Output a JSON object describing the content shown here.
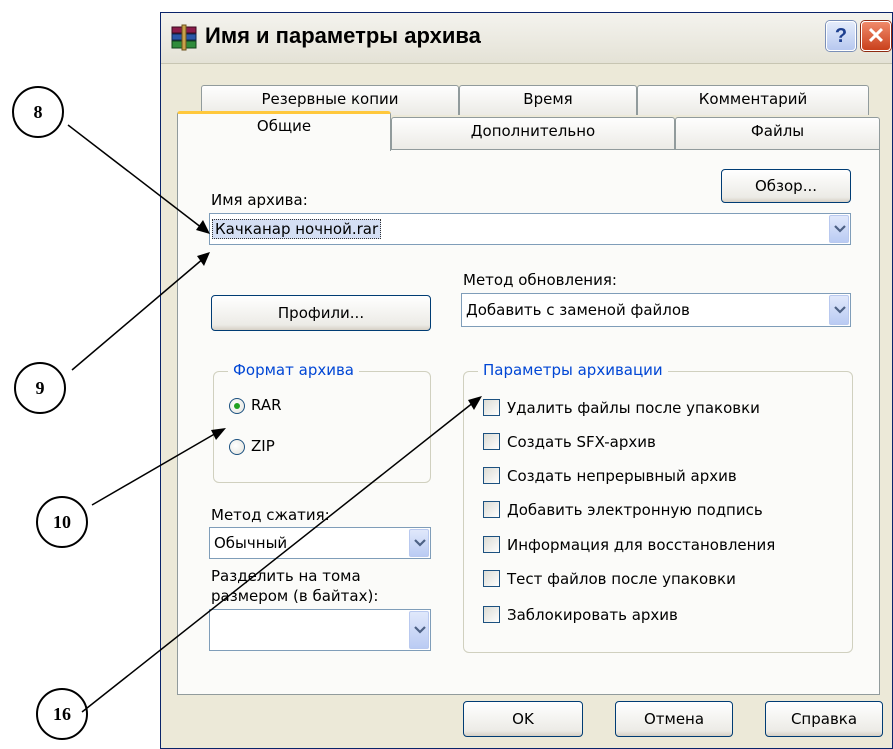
{
  "window": {
    "title": "Имя и параметры архива",
    "help_glyph": "?",
    "close_glyph": "✕"
  },
  "tabs_back": [
    "Резервные копии",
    "Время",
    "Комментарий"
  ],
  "tabs_front": [
    "Общие",
    "Дополнительно",
    "Файлы"
  ],
  "active_tab": "Общие",
  "general": {
    "archive_name_label": "Имя архива:",
    "browse_button": "Обзор...",
    "archive_name_value": "Качканар ночной.rar",
    "update_method_label": "Метод обновления:",
    "update_method_value": "Добавить с заменой файлов",
    "profiles_button": "Профили...",
    "format_group_title": "Формат архива",
    "format_options": [
      "RAR",
      "ZIP"
    ],
    "format_selected": "RAR",
    "compression_label": "Метод сжатия:",
    "compression_value": "Обычный",
    "split_label_line1": "Разделить на тома",
    "split_label_line2": "размером (в байтах):",
    "split_value": "",
    "options_group_title": "Параметры архивации",
    "options": [
      "Удалить файлы после упаковки",
      "Создать SFX-архив",
      "Создать непрерывный архив",
      "Добавить электронную подпись",
      "Информация для восстановления",
      "Тест файлов после упаковки",
      "Заблокировать архив"
    ],
    "options_checked": [
      false,
      false,
      false,
      false,
      false,
      false,
      false
    ]
  },
  "buttons": {
    "ok": "OK",
    "cancel": "Отмена",
    "help": "Справка"
  },
  "callouts": [
    "8",
    "9",
    "10",
    "16"
  ],
  "colors": {
    "window_bg": "#ece9d8",
    "panel_bg": "#fbfbf9",
    "group_title": "#0046d5",
    "active_tab_accent": "#ffc83c",
    "radio_dot": "#21a121"
  }
}
